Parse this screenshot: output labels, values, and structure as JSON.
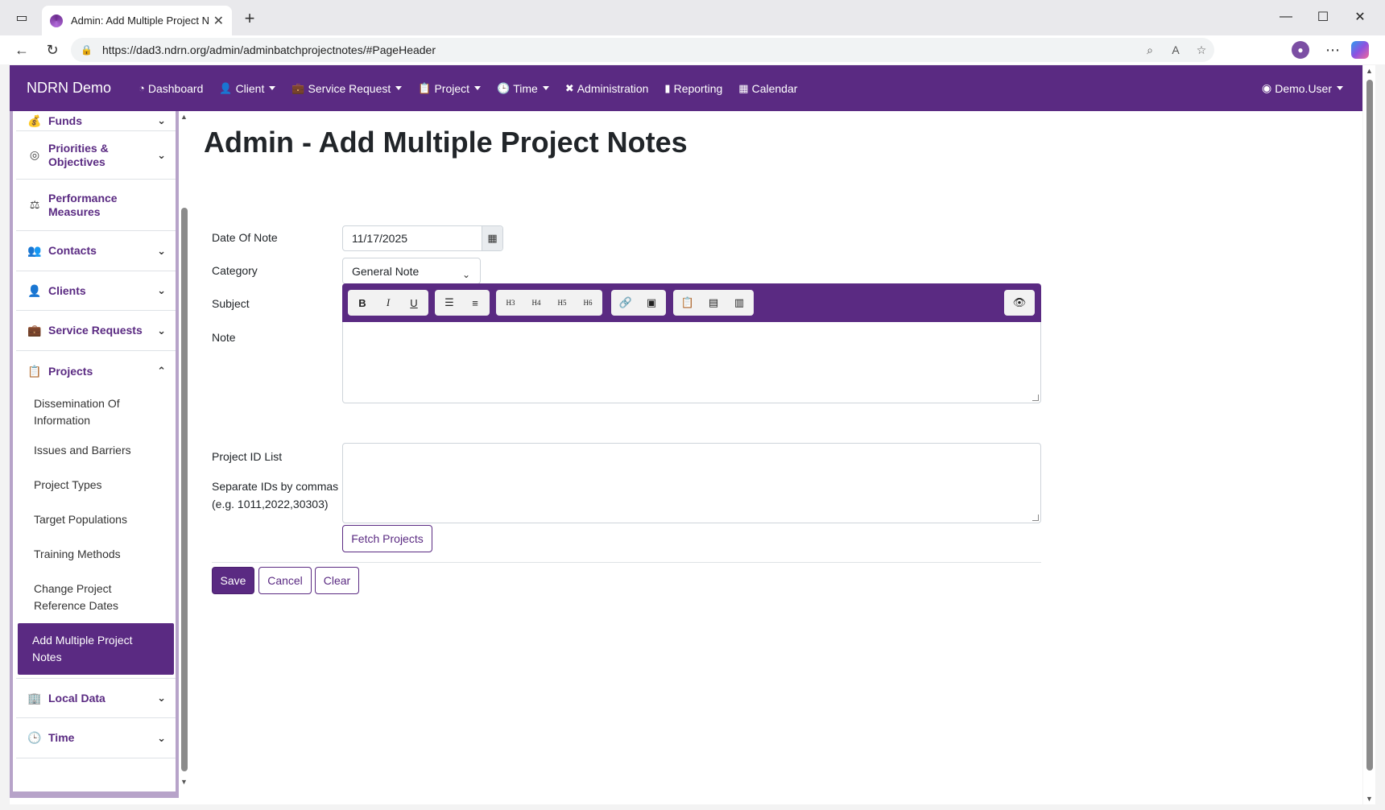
{
  "browser": {
    "tab_title": "Admin: Add Multiple Project Notes",
    "url": "https://dad3.ndrn.org/admin/adminbatchprojectnotes/#PageHeader"
  },
  "navbar": {
    "brand": "NDRN Demo",
    "items": [
      {
        "label": "Dashboard",
        "icon": "dashboard-icon",
        "dropdown": false
      },
      {
        "label": "Client",
        "icon": "user-icon",
        "dropdown": true
      },
      {
        "label": "Service Request",
        "icon": "briefcase-icon",
        "dropdown": true
      },
      {
        "label": "Project",
        "icon": "clipboard-icon",
        "dropdown": true
      },
      {
        "label": "Time",
        "icon": "clock-icon",
        "dropdown": true
      },
      {
        "label": "Administration",
        "icon": "tools-icon",
        "dropdown": false
      },
      {
        "label": "Reporting",
        "icon": "file-icon",
        "dropdown": false
      },
      {
        "label": "Calendar",
        "icon": "calendar-icon",
        "dropdown": false
      }
    ],
    "user": "Demo.User"
  },
  "sidebar": {
    "items": [
      {
        "label": "Funds",
        "icon": "money-bag-icon",
        "expanded": false
      },
      {
        "label": "Priorities & Objectives",
        "icon": "target-icon",
        "expanded": false
      },
      {
        "label": "Performance Measures",
        "icon": "scale-icon",
        "expanded": null
      },
      {
        "label": "Contacts",
        "icon": "users-icon",
        "expanded": false
      },
      {
        "label": "Clients",
        "icon": "user-icon",
        "expanded": false
      },
      {
        "label": "Service Requests",
        "icon": "briefcase-icon",
        "expanded": false
      },
      {
        "label": "Projects",
        "icon": "clipboard-icon",
        "expanded": true
      }
    ],
    "project_subitems": [
      "Dissemination Of Information",
      "Issues and Barriers",
      "Project Types",
      "Target Populations",
      "Training Methods",
      "Change Project Reference Dates",
      "Add Multiple Project Notes"
    ],
    "active_subitem": "Add Multiple Project Notes",
    "bottom_items": [
      {
        "label": "Local Data",
        "icon": "building-icon"
      },
      {
        "label": "Time",
        "icon": "clock-icon"
      }
    ]
  },
  "page": {
    "title": "Admin - Add Multiple Project Notes",
    "date_label": "Date Of Note",
    "date_value": "11/17/2025",
    "category_label": "Category",
    "category_value": "General Note",
    "subject_label": "Subject",
    "subject_value": "",
    "note_label": "Note",
    "project_ids_label": "Project ID List",
    "project_ids_help": "Separate IDs by commas (e.g. 1011,2022,30303)",
    "fetch_button": "Fetch Projects",
    "save_button": "Save",
    "cancel_button": "Cancel",
    "clear_button": "Clear"
  },
  "editor_toolbar": {
    "heading_labels": [
      "H3",
      "H4",
      "H5",
      "H6"
    ]
  },
  "colors": {
    "brand_purple": "#5a2a82"
  }
}
